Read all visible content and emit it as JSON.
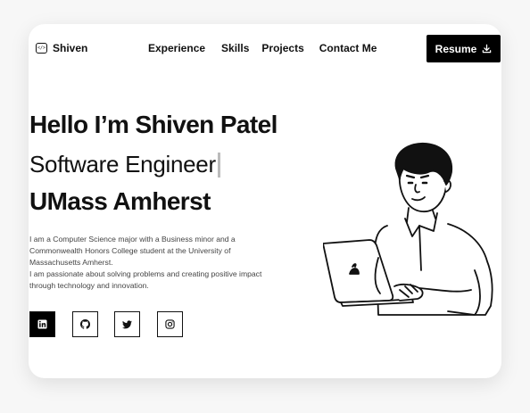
{
  "brand": {
    "name": "Shiven",
    "logo_icon": "code-icon",
    "logo_glyph": "</>"
  },
  "nav": {
    "links": [
      "Experience",
      "Skills",
      "Projects",
      "Contact Me"
    ],
    "resume_label": "Resume",
    "resume_icon": "download-icon"
  },
  "hero": {
    "greeting": "Hello I’m Shiven Patel",
    "role": "Software Engineer",
    "school": "UMass Amherst",
    "bio_line1": "I am a Computer Science major with a Business minor and a Commonwealth Honors College student at the University of Massachusetts Amherst.",
    "bio_line2": "I am passionate about solving problems and creating positive impact through technology and innovation."
  },
  "socials": [
    {
      "icon": "linkedin-icon",
      "active": true
    },
    {
      "icon": "github-icon",
      "active": false
    },
    {
      "icon": "twitter-icon",
      "active": false
    },
    {
      "icon": "instagram-icon",
      "active": false
    }
  ],
  "colors": {
    "accent": "#000000",
    "background": "#f7f7f7",
    "card": "#ffffff",
    "text": "#111111",
    "muted": "#444444"
  }
}
